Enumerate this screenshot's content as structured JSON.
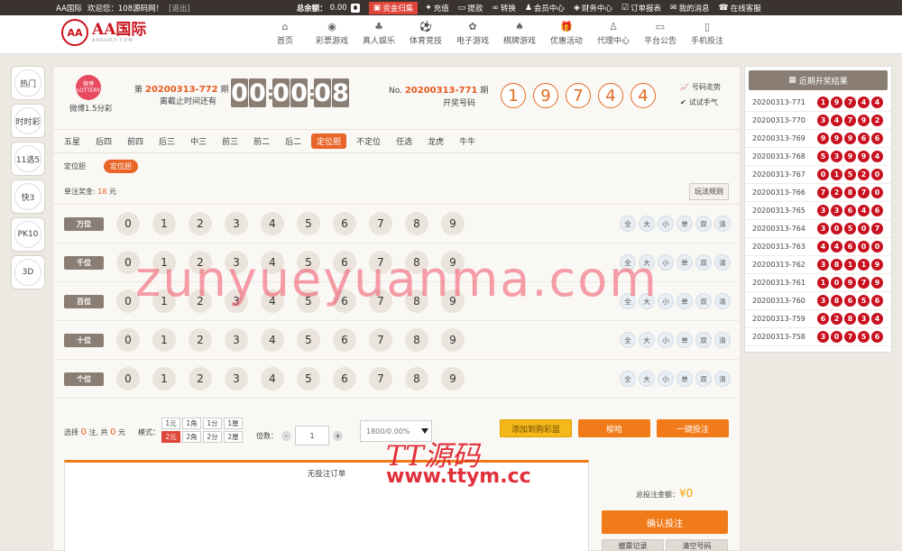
{
  "topbar": {
    "site": "AA国际",
    "welcome": "欢迎您：108源码网！",
    "logout": "[退出]",
    "balance_label": "总余额：",
    "balance": "0.00",
    "links": [
      {
        "icon": "wallet-icon",
        "label": "资金归集",
        "hl": true
      },
      {
        "icon": "money-icon",
        "label": "充值"
      },
      {
        "icon": "card-icon",
        "label": "提款"
      },
      {
        "icon": "exchange-icon",
        "label": "转换"
      },
      {
        "icon": "user-icon",
        "label": "会员中心"
      },
      {
        "icon": "finance-icon",
        "label": "财务中心"
      },
      {
        "icon": "order-icon",
        "label": "订单报表"
      },
      {
        "icon": "mail-icon",
        "label": "我的消息"
      },
      {
        "icon": "support-icon",
        "label": "在线客服"
      }
    ]
  },
  "header": {
    "logo_text": "AA国际",
    "logo_sub": "AAGUOJI.COM",
    "logo_mark": "AA",
    "nav": [
      {
        "label": "首页",
        "icon": "⌂"
      },
      {
        "label": "彩票游戏",
        "icon": "◉"
      },
      {
        "label": "真人娱乐",
        "icon": "♣"
      },
      {
        "label": "体育竞技",
        "icon": "⚽"
      },
      {
        "label": "电子游戏",
        "icon": "✿"
      },
      {
        "label": "棋牌游戏",
        "icon": "♠"
      },
      {
        "label": "优惠活动",
        "icon": "🎁"
      },
      {
        "label": "代理中心",
        "icon": "♙"
      },
      {
        "label": "平台公告",
        "icon": "▭"
      },
      {
        "label": "手机投注",
        "icon": "▯"
      }
    ]
  },
  "left": [
    "热门",
    "时时彩",
    "11选5",
    "快3",
    "PK10",
    "3D"
  ],
  "lottery": {
    "logo": "微博 LOTTERY",
    "name": "微博1.5分彩",
    "issue_prefix": "第",
    "issue": "20200313-772",
    "issue_suffix": "期",
    "countdown_label": "离截止时间还有",
    "cd": [
      "0",
      "0",
      "0",
      "0",
      "0",
      "8"
    ],
    "last_prefix": "No.",
    "last_issue": "20200313-771",
    "last_suffix": "期",
    "open_label": "开奖号码",
    "result": [
      "1",
      "9",
      "7",
      "4",
      "4"
    ],
    "trend": "号码走势",
    "try": "试试手气"
  },
  "tabs": [
    "五星",
    "后四",
    "前四",
    "后三",
    "中三",
    "前三",
    "前二",
    "后二",
    "定位胆",
    "不定位",
    "任选",
    "龙虎",
    "牛牛"
  ],
  "active_tab": "定位胆",
  "subtab": {
    "label": "定位胆",
    "active": "定位胆"
  },
  "prize": {
    "label": "单注奖金:",
    "value": "18",
    "unit": "元",
    "rule": "玩法规则"
  },
  "rows": [
    {
      "pos": "万位"
    },
    {
      "pos": "千位"
    },
    {
      "pos": "百位"
    },
    {
      "pos": "十位"
    },
    {
      "pos": "个位"
    }
  ],
  "digits": [
    "0",
    "1",
    "2",
    "3",
    "4",
    "5",
    "6",
    "7",
    "8",
    "9"
  ],
  "quick": [
    "全",
    "大",
    "小",
    "单",
    "双",
    "清"
  ],
  "bet": {
    "sel_label": "选择",
    "sel_count": "0",
    "sel_unit": "注, 共",
    "sel_amount": "0",
    "sel_yuan": "元",
    "mode_label": "模式：",
    "modes": [
      "1元",
      "1角",
      "1分",
      "1厘",
      "2元",
      "2角",
      "2分",
      "2厘"
    ],
    "mode_on": "2元",
    "mult_label": "倍数：",
    "mult_value": "1",
    "minus": "-",
    "plus": "+",
    "rate": "1800/0.00%",
    "cart": "添加到购彩篮",
    "cheat": "梭哈",
    "quick": "一键投注"
  },
  "order": {
    "empty": "无投注订单",
    "total_label": "总投注金额：",
    "total_symbol": "¥",
    "total": "0",
    "confirm": "确认投注",
    "btn1": "撤票记录",
    "btn2": "清空号码"
  },
  "recent": {
    "title": "近期开奖结果",
    "items": [
      {
        "id": "20200313-771",
        "n": [
          "1",
          "9",
          "7",
          "4",
          "4"
        ]
      },
      {
        "id": "20200313-770",
        "n": [
          "3",
          "4",
          "7",
          "9",
          "2"
        ]
      },
      {
        "id": "20200313-769",
        "n": [
          "9",
          "9",
          "9",
          "6",
          "6"
        ]
      },
      {
        "id": "20200313-768",
        "n": [
          "5",
          "3",
          "9",
          "9",
          "4"
        ]
      },
      {
        "id": "20200313-767",
        "n": [
          "0",
          "1",
          "5",
          "2",
          "0"
        ]
      },
      {
        "id": "20200313-766",
        "n": [
          "7",
          "2",
          "8",
          "7",
          "0"
        ]
      },
      {
        "id": "20200313-765",
        "n": [
          "3",
          "3",
          "6",
          "4",
          "6"
        ]
      },
      {
        "id": "20200313-764",
        "n": [
          "3",
          "0",
          "5",
          "0",
          "7"
        ]
      },
      {
        "id": "20200313-763",
        "n": [
          "4",
          "4",
          "6",
          "0",
          "0"
        ]
      },
      {
        "id": "20200313-762",
        "n": [
          "3",
          "8",
          "1",
          "1",
          "9"
        ]
      },
      {
        "id": "20200313-761",
        "n": [
          "1",
          "0",
          "9",
          "7",
          "9"
        ]
      },
      {
        "id": "20200313-760",
        "n": [
          "3",
          "8",
          "6",
          "5",
          "6"
        ]
      },
      {
        "id": "20200313-759",
        "n": [
          "6",
          "2",
          "8",
          "3",
          "4"
        ]
      },
      {
        "id": "20200313-758",
        "n": [
          "3",
          "0",
          "7",
          "5",
          "6"
        ]
      }
    ]
  },
  "watermark": {
    "main": "zunyueyuanma.com",
    "logo": "TT源码",
    "url": "www.ttym.cc"
  }
}
